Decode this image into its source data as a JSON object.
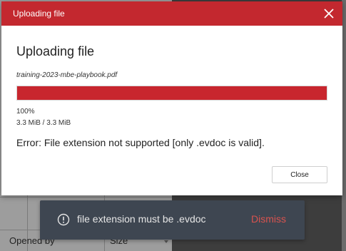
{
  "background": {
    "table_headers": [
      "Opened by",
      "Size"
    ]
  },
  "modal": {
    "header_title": "Uploading file",
    "heading": "Uploading file",
    "file_name": "training-2023-mbe-playbook.pdf",
    "progress": {
      "percent_value": 100,
      "percent_label": "100%",
      "size_label": "3.3 MiB / 3.3 MiB"
    },
    "error_message": "Error: File extension not supported [only .evdoc is valid].",
    "close_button_label": "Close",
    "close_icon": "close-icon"
  },
  "toast": {
    "icon": "info-circle-icon",
    "message": "file extension must be .evdoc",
    "dismiss_label": "Dismiss"
  },
  "colors": {
    "accent": "#c3282f",
    "toast_bg": "#3e4651",
    "dismiss": "#d9534f"
  }
}
